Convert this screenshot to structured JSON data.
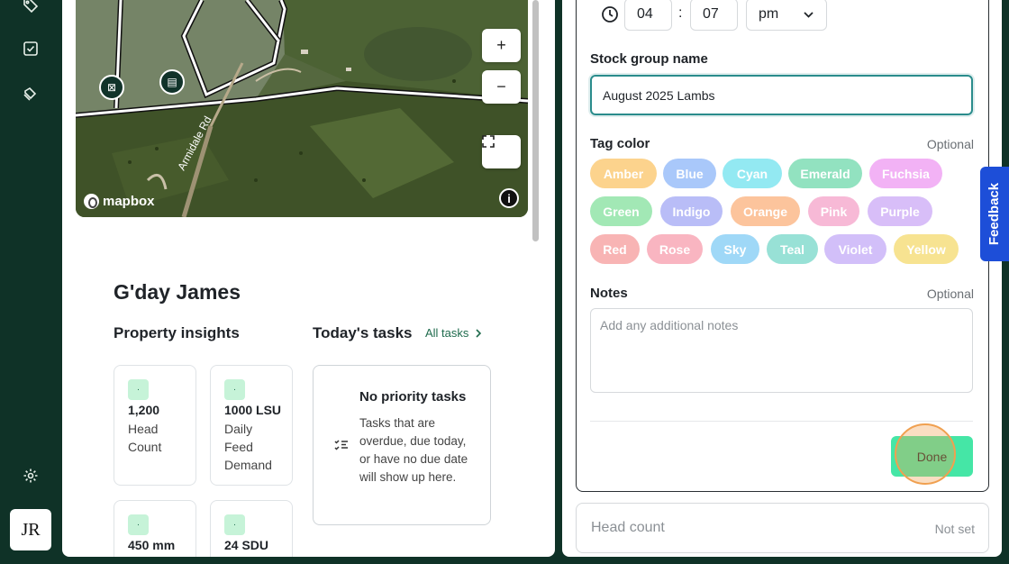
{
  "rail": {
    "icons": [
      "tag-icon",
      "checkbox-icon",
      "tags-icon",
      "settings-icon"
    ],
    "avatar_initials": "JR"
  },
  "map": {
    "road_label": "Armidale Rd",
    "attribution": "mapbox",
    "zoom_in": "+",
    "zoom_out": "−",
    "info": "i"
  },
  "dashboard": {
    "greeting": "G'day James",
    "insights_title": "Property insights",
    "tasks_title": "Today's tasks",
    "all_tasks_link": "All tasks",
    "stats": [
      {
        "value": "1,200",
        "label": "Head Count"
      },
      {
        "value": "1000  LSU",
        "label": "Daily Feed Demand"
      },
      {
        "value": "450  mm",
        "label": ""
      },
      {
        "value": "24  SDU",
        "label": ""
      }
    ],
    "no_tasks_title": "No priority tasks",
    "no_tasks_body": "Tasks that are overdue, due today, or have no due date will show up here."
  },
  "form": {
    "time_hour": "04",
    "time_minute": "07",
    "time_separator": ":",
    "time_period": "pm",
    "stock_group_label": "Stock group name",
    "stock_group_value": "August 2025 Lambs",
    "tag_color_label": "Tag color",
    "tag_color_optional": "Optional",
    "tag_colors": [
      {
        "name": "Amber",
        "color": "#fcd38d"
      },
      {
        "name": "Blue",
        "color": "#a9c8fa"
      },
      {
        "name": "Cyan",
        "color": "#93e9f2"
      },
      {
        "name": "Emerald",
        "color": "#92e2c0"
      },
      {
        "name": "Fuchsia",
        "color": "#f2b2f5"
      },
      {
        "name": "Green",
        "color": "#a2e8b5"
      },
      {
        "name": "Indigo",
        "color": "#b9bdf7"
      },
      {
        "name": "Orange",
        "color": "#fcc49c"
      },
      {
        "name": "Pink",
        "color": "#f7b9d6"
      },
      {
        "name": "Purple",
        "color": "#d8bef8"
      },
      {
        "name": "Red",
        "color": "#f8b4b4"
      },
      {
        "name": "Rose",
        "color": "#f9b5c1"
      },
      {
        "name": "Sky",
        "color": "#9fd8f7"
      },
      {
        "name": "Teal",
        "color": "#98e1d6"
      },
      {
        "name": "Violet",
        "color": "#d2bff9"
      },
      {
        "name": "Yellow",
        "color": "#f7e391"
      }
    ],
    "notes_label": "Notes",
    "notes_optional": "Optional",
    "notes_placeholder": "Add any additional notes",
    "done_label": "Done",
    "head_count_label": "Head count",
    "head_count_value": "Not set"
  },
  "feedback_label": "Feedback",
  "colors": {
    "sidebar_bg": "#0f3227",
    "accent_green": "#45e6a6",
    "input_focus": "#2a8c8c",
    "feedback_blue": "#1d4ed8"
  }
}
